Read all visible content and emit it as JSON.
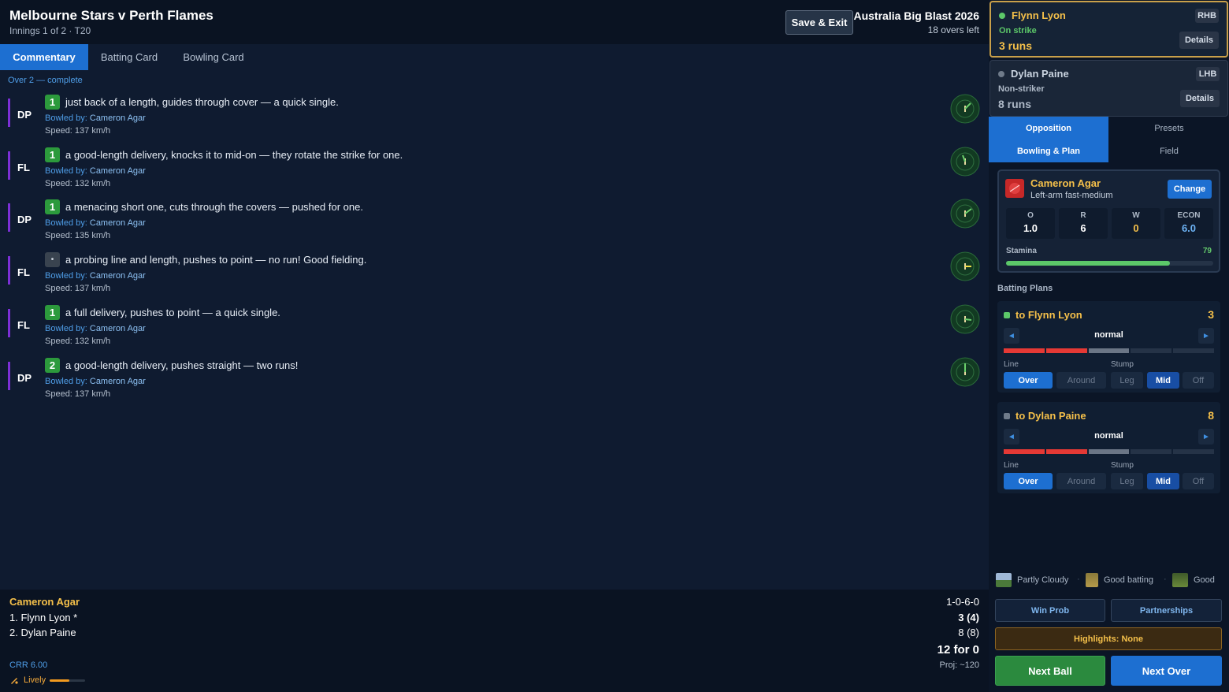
{
  "header": {
    "title": "Melbourne Stars v Perth Flames",
    "subtitle": "Innings 1 of 2 · T20",
    "save_label": "Save & Exit",
    "competition": "Australia Big Blast 2026",
    "overs_left": "18 overs left"
  },
  "tabs": [
    "Commentary",
    "Batting Card",
    "Bowling Card"
  ],
  "over_label": "Over 2 — complete",
  "balls": [
    {
      "batter": "DP",
      "runs": "1",
      "text": "just back of a length, guides through cover — a quick single.",
      "bowled_prefix": "Bowled by:",
      "bowler": "Cameron Agar",
      "speed": "Speed: 137 km/h"
    },
    {
      "batter": "FL",
      "runs": "1",
      "text": "a good-length delivery, knocks it to mid-on — they rotate the strike for one.",
      "bowled_prefix": "Bowled by:",
      "bowler": "Cameron Agar",
      "speed": "Speed: 132 km/h"
    },
    {
      "batter": "DP",
      "runs": "1",
      "text": "a menacing short one, cuts through the covers — pushed for one.",
      "bowled_prefix": "Bowled by:",
      "bowler": "Cameron Agar",
      "speed": "Speed: 135 km/h"
    },
    {
      "batter": "FL",
      "runs": "•",
      "text": "a probing line and length, pushes to point — no run! Good fielding.",
      "bowled_prefix": "Bowled by:",
      "bowler": "Cameron Agar",
      "speed": "Speed: 137 km/h"
    },
    {
      "batter": "FL",
      "runs": "1",
      "text": "a full delivery, pushes to point — a quick single.",
      "bowled_prefix": "Bowled by:",
      "bowler": "Cameron Agar",
      "speed": "Speed: 132 km/h"
    },
    {
      "batter": "DP",
      "runs": "2",
      "text": "a good-length delivery, pushes straight — two runs!",
      "bowled_prefix": "Bowled by:",
      "bowler": "Cameron Agar",
      "speed": "Speed: 137 km/h"
    }
  ],
  "scoreboard": {
    "bowler": "Cameron Agar",
    "bowler_figures": "1-0-6-0",
    "batter1": "1. Flynn Lyon *",
    "batter1_score": "3 (4)",
    "batter2": "2. Dylan Paine",
    "batter2_score": "8 (8)",
    "total": "12 for 0",
    "projection": "Proj: ~120",
    "crr": "CRR 6.00",
    "pitch": "Lively",
    "pitch_level": 0.55
  },
  "batters": [
    {
      "name": "Flynn Lyon",
      "hand": "RHB",
      "role": "On strike",
      "runs": "3 runs",
      "details": "Details",
      "name_color": "#f5c04a",
      "role_color": "#5cc869",
      "runs_color": "#f5c04a",
      "dot_color": "#5cc869"
    },
    {
      "name": "Dylan Paine",
      "hand": "LHB",
      "role": "Non-striker",
      "runs": "8 runs",
      "details": "Details",
      "name_color": "#c9d3df",
      "role_color": "#aeb9c7",
      "runs_color": "#aeb9c7",
      "dot_color": "#6f7b8a"
    }
  ],
  "side_tabs": [
    "Opposition",
    "Presets",
    "Bowling & Plan",
    "Field"
  ],
  "bowler_card": {
    "name": "Cameron Agar",
    "type": "Left-arm fast-medium",
    "change": "Change",
    "stats": [
      {
        "label": "O",
        "value": "1.0",
        "color": "#ffffff"
      },
      {
        "label": "R",
        "value": "6",
        "color": "#ffffff"
      },
      {
        "label": "W",
        "value": "0",
        "color": "#f5c04a"
      },
      {
        "label": "ECON",
        "value": "6.0",
        "color": "#6db3f5"
      }
    ],
    "stamina_label": "Stamina",
    "stamina": "79",
    "stamina_level": 0.79
  },
  "plans_title": "Batting Plans",
  "plans": [
    {
      "name": "to Flynn Lyon",
      "score": "3",
      "dot_color": "#5cc869",
      "mode": "normal",
      "line_label": "Line",
      "stump_label": "Stump",
      "line_options": [
        "Over",
        "Around"
      ],
      "stump_options": [
        "Leg",
        "Mid",
        "Off"
      ]
    },
    {
      "name": "to Dylan Paine",
      "score": "8",
      "dot_color": "#6f7b8a",
      "mode": "normal",
      "line_label": "Line",
      "stump_label": "Stump",
      "line_options": [
        "Over",
        "Around"
      ],
      "stump_options": [
        "Leg",
        "Mid",
        "Off"
      ]
    }
  ],
  "conditions": [
    "Partly Cloudy",
    "Good batting",
    "Good"
  ],
  "buttons": {
    "win_prob": "Win Prob",
    "partnerships": "Partnerships",
    "highlights": "Highlights: None",
    "next_ball": "Next Ball",
    "next_over": "Next Over"
  }
}
